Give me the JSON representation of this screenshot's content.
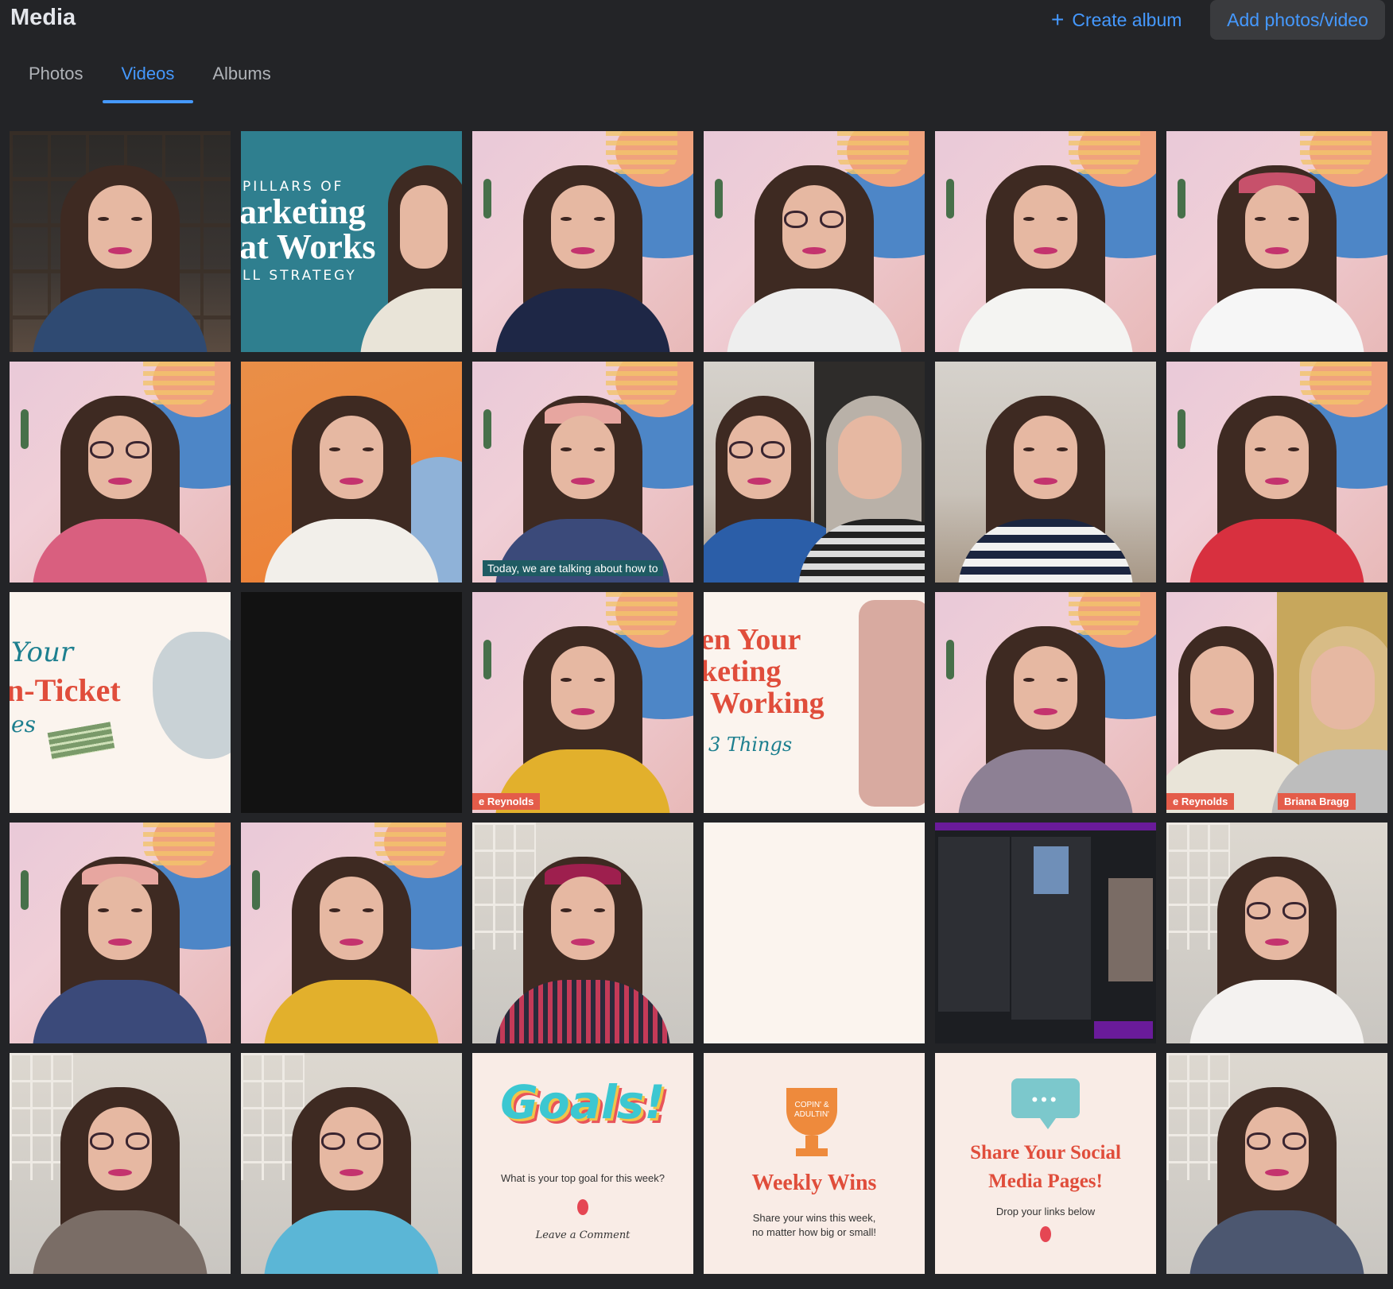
{
  "header": {
    "title": "Media",
    "create_album_label": "Create album",
    "add_label": "Add photos/video"
  },
  "tabs": [
    {
      "label": "Photos",
      "active": false
    },
    {
      "label": "Videos",
      "active": true
    },
    {
      "label": "Albums",
      "active": false
    }
  ],
  "colors": {
    "accent": "#4599ff",
    "background": "#232427",
    "tab_inactive": "#b0b3b8"
  },
  "tiles": {
    "t2": {
      "line1": "PILLARS OF",
      "line2": "arketing",
      "line3": "at Works",
      "line4": "LL STRATEGY"
    },
    "t9": {
      "caption": "Today, we are talking about how to"
    },
    "t13": {
      "line1": "Your",
      "line2": "n-Ticket",
      "line3": "es"
    },
    "t15": {
      "name": "e Reynolds"
    },
    "t16": {
      "line1": "en Your",
      "line2": "keting",
      "line3": "Working",
      "line4": "3 Things"
    },
    "t18": {
      "name1": "e Reynolds",
      "name2": "Briana Bragg"
    },
    "t27": {
      "title": "Goals!",
      "prompt": "What is your top goal for this week?",
      "cta": "Leave a Comment"
    },
    "t28": {
      "badge": "COPIN' & ADULTIN'",
      "title": "Weekly Wins",
      "line1": "Share your wins this week,",
      "line2": "no matter how big or small!"
    },
    "t29": {
      "dots": "•••",
      "title1": "Share Your Social",
      "title2": "Media Pages!",
      "sub": "Drop your links below"
    }
  }
}
